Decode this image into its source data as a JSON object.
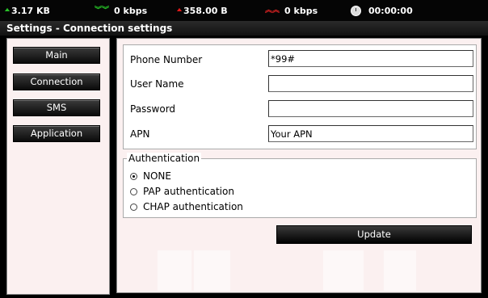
{
  "status": {
    "received": "3.17 KB",
    "download_speed": "0 kbps",
    "sent": "358.00 B",
    "upload_speed": "0 kbps",
    "duration": "00:00:00",
    "colors": {
      "green": "#29c229",
      "red": "#e01a1a"
    }
  },
  "title": "Settings - Connection settings",
  "nav": {
    "items": [
      {
        "label": "Main"
      },
      {
        "label": "Connection"
      },
      {
        "label": "SMS"
      },
      {
        "label": "Application"
      }
    ]
  },
  "form": {
    "phone": {
      "label": "Phone Number",
      "value": "*99#"
    },
    "user": {
      "label": "User Name",
      "value": ""
    },
    "password": {
      "label": "Password",
      "value": ""
    },
    "apn": {
      "label": "APN",
      "value": "Your APN"
    }
  },
  "auth": {
    "legend": "Authentication",
    "options": [
      {
        "label": "NONE",
        "selected": true
      },
      {
        "label": "PAP authentication",
        "selected": false
      },
      {
        "label": "CHAP authentication",
        "selected": false
      }
    ]
  },
  "update_label": "Update"
}
